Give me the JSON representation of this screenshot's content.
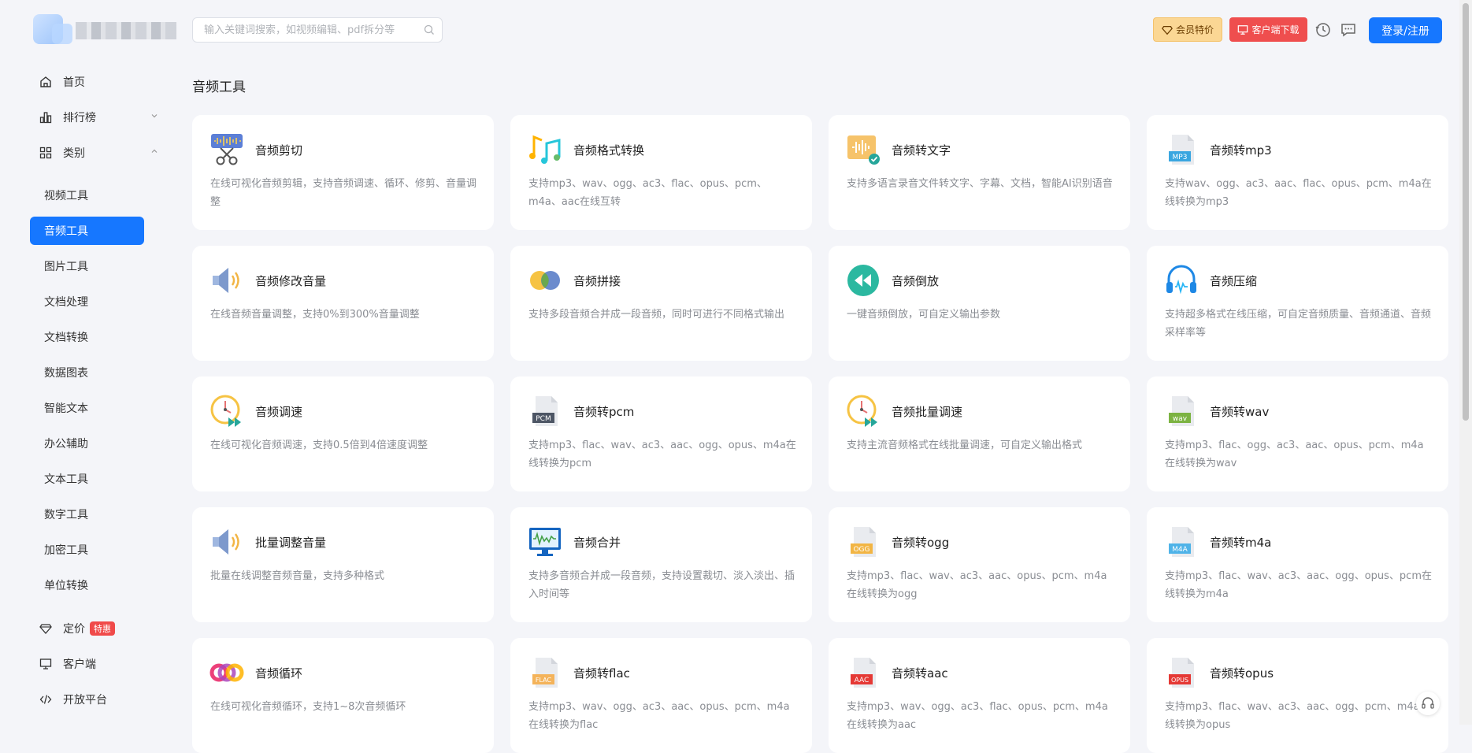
{
  "search": {
    "placeholder": "输入关键词搜索，如视频编辑、pdf拆分等"
  },
  "header": {
    "vip_label": "会员特价",
    "client_label": "客户端下载",
    "login_label": "登录/注册"
  },
  "sidebar": {
    "home": "首页",
    "ranking": "排行榜",
    "category": "类别",
    "categories": [
      "视频工具",
      "音频工具",
      "图片工具",
      "文档处理",
      "文档转换",
      "数据图表",
      "智能文本",
      "办公辅助",
      "文本工具",
      "数字工具",
      "加密工具",
      "单位转换"
    ],
    "active_category": "音频工具",
    "pricing": "定价",
    "pricing_badge": "特惠",
    "client": "客户端",
    "open_platform": "开放平台"
  },
  "main": {
    "section_title": "音频工具",
    "tools": [
      {
        "title": "音频剪切",
        "desc": "在线可视化音频剪辑，支持音频调速、循环、修剪、音量调整",
        "icon": "audio-cut-icon"
      },
      {
        "title": "音频格式转换",
        "desc": "支持mp3、wav、ogg、ac3、flac、opus、pcm、m4a、aac在线互转",
        "icon": "music-notes-icon"
      },
      {
        "title": "音频转文字",
        "desc": "支持多语言录音文件转文字、字幕、文档，智能AI识别语音",
        "icon": "audio-to-text-icon"
      },
      {
        "title": "音频转mp3",
        "desc": "支持wav、ogg、ac3、aac、flac、opus、pcm、m4a在线转换为mp3",
        "icon": "file-mp3-icon",
        "file_label": "MP3",
        "file_color": "#3aa6e0"
      },
      {
        "title": "音频修改音量",
        "desc": "在线音频音量调整，支持0%到300%音量调整",
        "icon": "speaker-icon"
      },
      {
        "title": "音频拼接",
        "desc": "支持多段音频合并成一段音频，同时可进行不同格式输出",
        "icon": "merge-circles-icon"
      },
      {
        "title": "音频倒放",
        "desc": "一键音频倒放，可自定义输出参数",
        "icon": "rewind-icon"
      },
      {
        "title": "音频压缩",
        "desc": "支持超多格式在线压缩，可自定音频质量、音频通道、音频采样率等",
        "icon": "headphones-icon"
      },
      {
        "title": "音频调速",
        "desc": "在线可视化音频调速，支持0.5倍到4倍速度调整",
        "icon": "clock-speed-icon"
      },
      {
        "title": "音频转pcm",
        "desc": "支持mp3、flac、wav、ac3、aac、ogg、opus、m4a在线转换为pcm",
        "icon": "file-pcm-icon",
        "file_label": "PCM",
        "file_color": "#4d5665"
      },
      {
        "title": "音频批量调速",
        "desc": "支持主流音频格式在线批量调速，可自定义输出格式",
        "icon": "clock-speed-icon"
      },
      {
        "title": "音频转wav",
        "desc": "支持mp3、flac、ogg、ac3、aac、opus、pcm、m4a在线转换为wav",
        "icon": "file-wav-icon",
        "file_label": "wav",
        "file_color": "#7cb342"
      },
      {
        "title": "批量调整音量",
        "desc": "批量在线调整音频音量，支持多种格式",
        "icon": "speaker-icon"
      },
      {
        "title": "音频合并",
        "desc": "支持多音频合并成一段音频，支持设置裁切、淡入淡出、插入时间等",
        "icon": "monitor-wave-icon"
      },
      {
        "title": "音频转ogg",
        "desc": "支持mp3、flac、wav、ac3、aac、opus、pcm、m4a在线转换为ogg",
        "icon": "file-ogg-icon",
        "file_label": "OGG",
        "file_color": "#f2b544"
      },
      {
        "title": "音频转m4a",
        "desc": "支持mp3、flac、wav、ac3、aac、ogg、opus、pcm在线转换为m4a",
        "icon": "file-m4a-icon",
        "file_label": "M4A",
        "file_color": "#4fb3e8"
      },
      {
        "title": "音频循环",
        "desc": "在线可视化音频循环，支持1~8次音频循环",
        "icon": "loop-rings-icon"
      },
      {
        "title": "音频转flac",
        "desc": "支持mp3、wav、ogg、ac3、aac、opus、pcm、m4a在线转换为flac",
        "icon": "file-flac-icon",
        "file_label": "FLAC",
        "file_color": "#f4b35a"
      },
      {
        "title": "音频转aac",
        "desc": "支持mp3、wav、ogg、ac3、flac、opus、pcm、m4a在线转换为aac",
        "icon": "file-aac-icon",
        "file_label": "AAC",
        "file_color": "#e53935"
      },
      {
        "title": "音频转opus",
        "desc": "支持mp3、flac、wav、ac3、aac、ogg、pcm、m4a在线转换为opus",
        "icon": "file-opus-icon",
        "file_label": "OPUS",
        "file_color": "#e53935"
      }
    ]
  }
}
